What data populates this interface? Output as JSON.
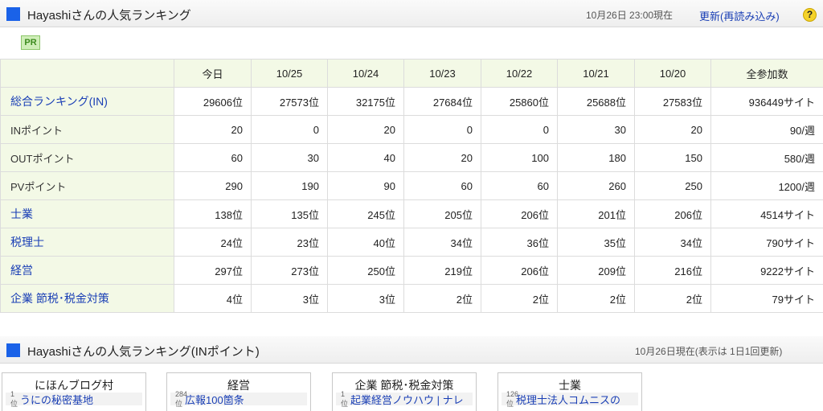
{
  "ranking": {
    "title": "Hayashiさんの人気ランキング",
    "timestamp": "10月26日 23:00現在",
    "refresh": "更新(再読み込み)",
    "help": "?",
    "pr": "PR",
    "columns": [
      "今日",
      "10/25",
      "10/24",
      "10/23",
      "10/22",
      "10/21",
      "10/20",
      "全参加数"
    ],
    "rows": [
      {
        "label": "総合ランキング(IN)",
        "link": true,
        "values": [
          "29606位",
          "27573位",
          "32175位",
          "27684位",
          "25860位",
          "25688位",
          "27583位",
          "936449サイト"
        ]
      },
      {
        "label": "INポイント",
        "link": false,
        "values": [
          "20",
          "0",
          "20",
          "0",
          "0",
          "30",
          "20",
          "90/週"
        ]
      },
      {
        "label": "OUTポイント",
        "link": false,
        "values": [
          "60",
          "30",
          "40",
          "20",
          "100",
          "180",
          "150",
          "580/週"
        ]
      },
      {
        "label": "PVポイント",
        "link": false,
        "values": [
          "290",
          "190",
          "90",
          "60",
          "60",
          "260",
          "250",
          "1200/週"
        ]
      },
      {
        "label": "士業",
        "link": true,
        "values": [
          "138位",
          "135位",
          "245位",
          "205位",
          "206位",
          "201位",
          "206位",
          "4514サイト"
        ]
      },
      {
        "label": "税理士",
        "link": true,
        "values": [
          "24位",
          "23位",
          "40位",
          "34位",
          "36位",
          "35位",
          "34位",
          "790サイト"
        ]
      },
      {
        "label": "経営",
        "link": true,
        "values": [
          "297位",
          "273位",
          "250位",
          "219位",
          "206位",
          "209位",
          "216位",
          "9222サイト"
        ]
      },
      {
        "label": "企業 節税･税金対策",
        "link": true,
        "values": [
          "4位",
          "3位",
          "3位",
          "2位",
          "2位",
          "2位",
          "2位",
          "79サイト"
        ]
      }
    ]
  },
  "in_ranking": {
    "title": "Hayashiさんの人気ランキング(INポイント)",
    "note": "10月26日現在(表示は 1日1回更新)",
    "boxes": [
      {
        "title": "にほんブログ村",
        "rank": "1位",
        "name": "うにの秘密基地"
      },
      {
        "title": "経営",
        "rank": "284位",
        "name": "広報100箇条"
      },
      {
        "title": "企業 節税･税金対策",
        "rank": "1位",
        "name": "起業経営ノウハウ | ナレ"
      },
      {
        "title": "士業",
        "rank": "126位",
        "name": "税理士法人コムニスの"
      }
    ]
  },
  "colors": {
    "accent": "#1a62e8",
    "link": "#1a3fb5",
    "label_bg": "#f3f9e6",
    "pr_bg": "#cfeeb8"
  }
}
